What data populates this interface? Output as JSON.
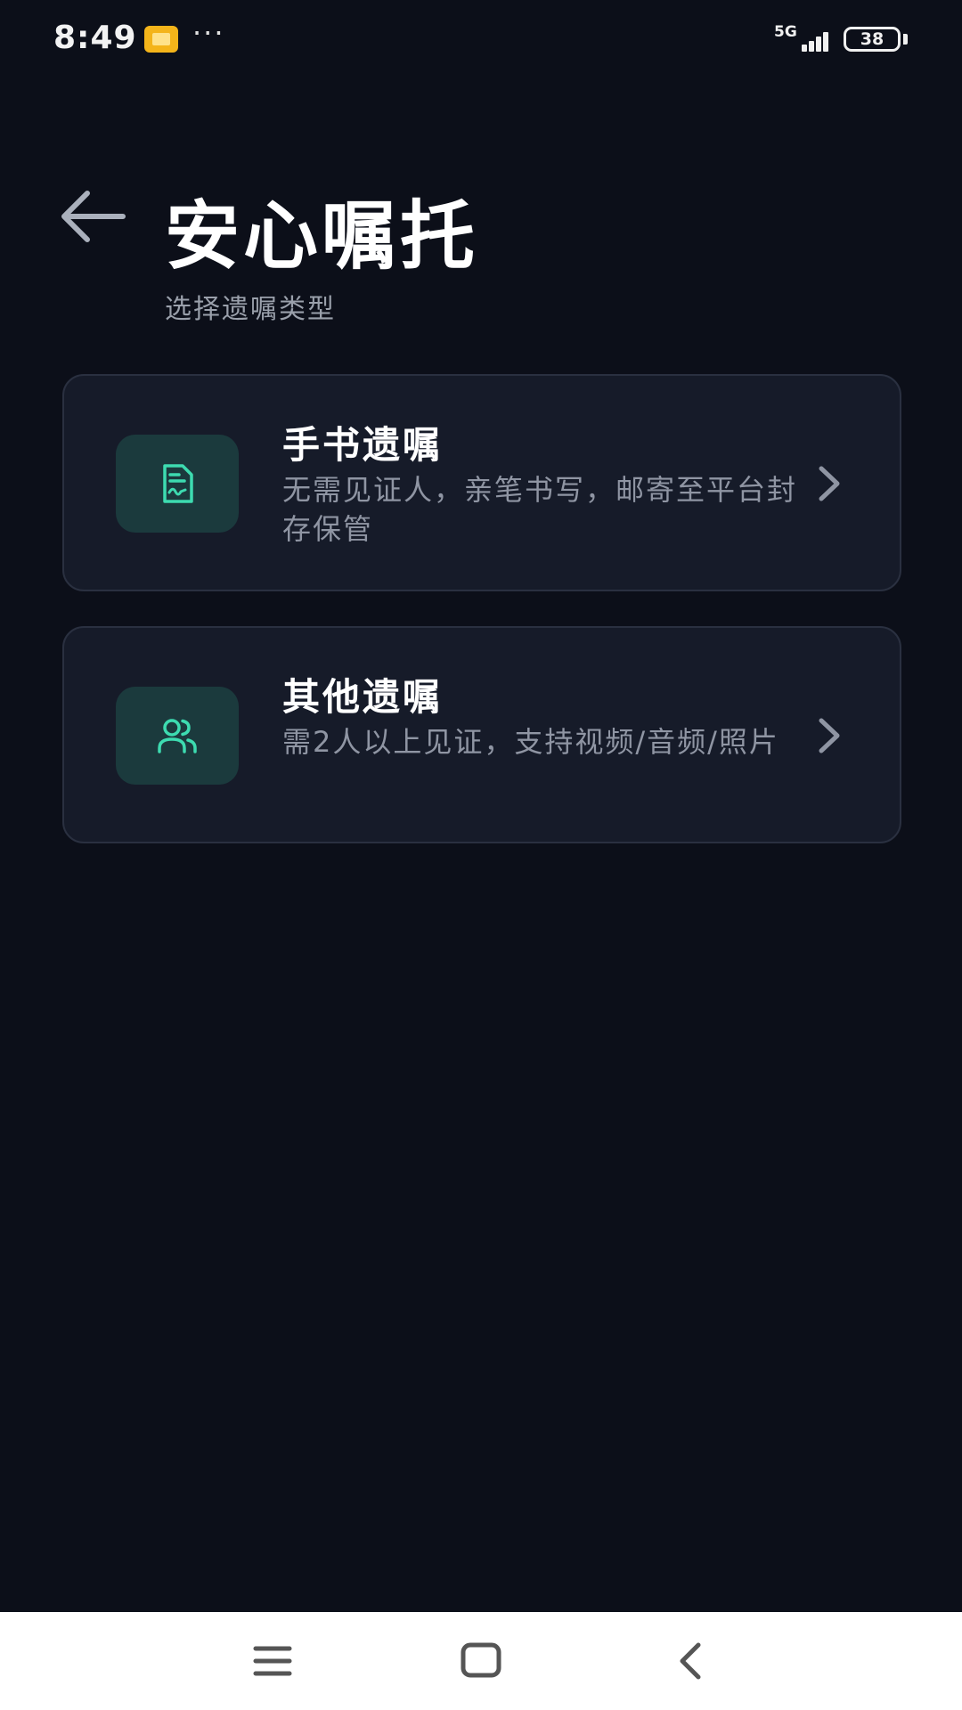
{
  "status_bar": {
    "time": "8:49",
    "network": "5G",
    "battery": "38",
    "more": "···"
  },
  "header": {
    "title": "安心嘱托",
    "subtitle": "选择遗嘱类型"
  },
  "options": [
    {
      "title": "手书遗嘱",
      "description": "无需见证人，亲笔书写，邮寄至平台封存保管",
      "icon": "document-signature-icon"
    },
    {
      "title": "其他遗嘱",
      "description": "需2人以上见证，支持视频/音频/照片",
      "icon": "users-icon"
    }
  ],
  "colors": {
    "background": "#0c0f19",
    "card": "#161b29",
    "accent": "#3ddbb0",
    "icon_box": "#1b3a3d"
  }
}
